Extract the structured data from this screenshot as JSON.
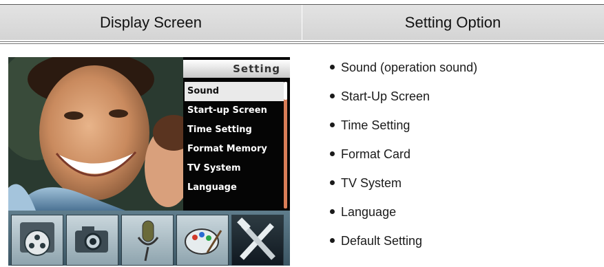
{
  "table": {
    "col_display": "Display Screen",
    "col_option": "Setting Option"
  },
  "screen": {
    "menu_title": "Setting",
    "menu_items": [
      "Sound",
      "Start-up Screen",
      "Time Setting",
      "Format Memory",
      "TV System",
      "Language"
    ],
    "selected_item": "Sound",
    "mode_icons": [
      "film-reel-icon",
      "camera-icon",
      "microphone-icon",
      "palette-icon",
      "tools-icon"
    ],
    "selected_mode": "tools-icon"
  },
  "options": [
    "Sound (operation sound)",
    "Start-Up Screen",
    "Time Setting",
    "Format Card",
    "TV System",
    "Language",
    "Default Setting"
  ]
}
